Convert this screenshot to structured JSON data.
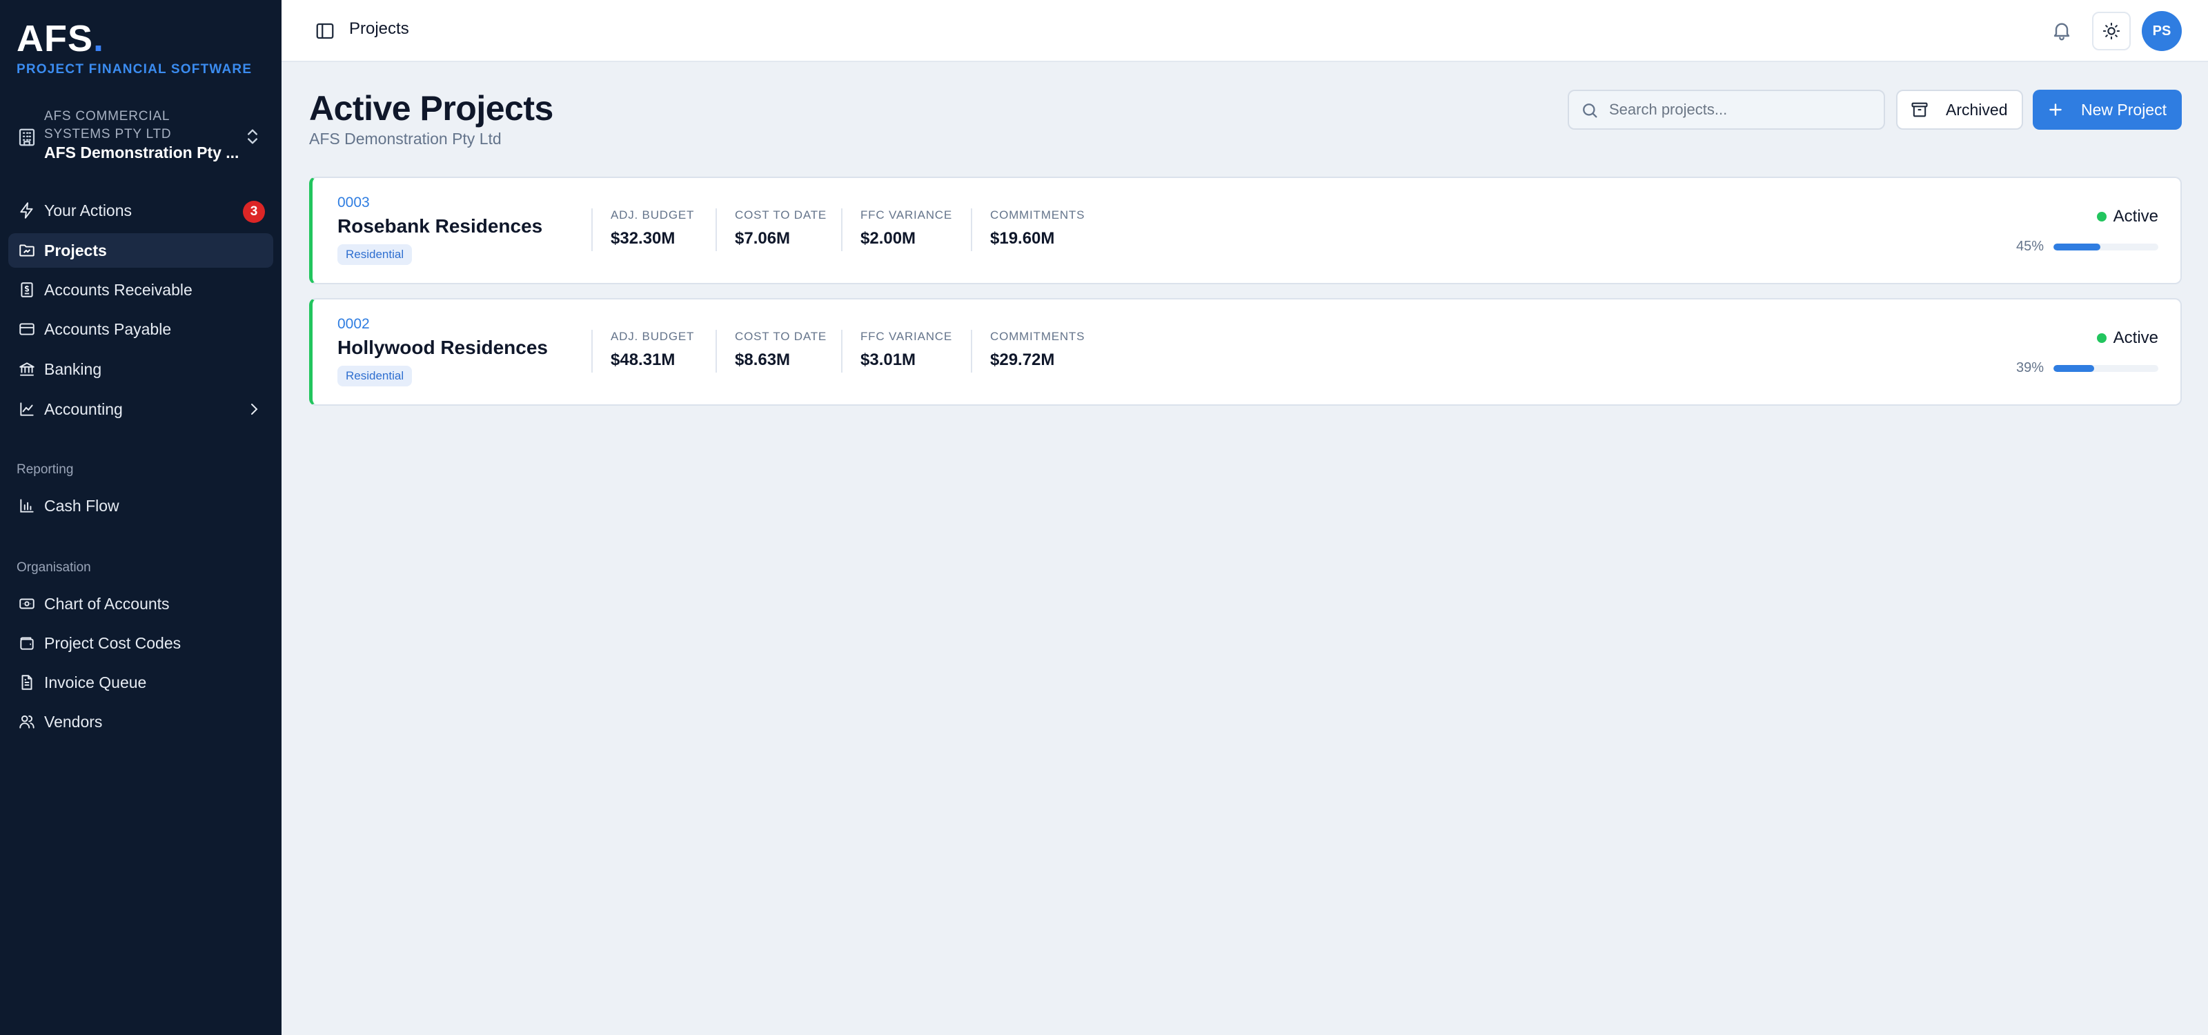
{
  "brand": {
    "logo_text": "AFS",
    "logo_dot": ".",
    "tagline": "PROJECT FINANCIAL SOFTWARE"
  },
  "org": {
    "parent": "AFS COMMERCIAL SYSTEMS PTY LTD",
    "name": "AFS Demonstration Pty ..."
  },
  "nav": {
    "items": [
      {
        "label": "Your Actions",
        "icon": "lightning-icon",
        "badge": "3"
      },
      {
        "label": "Projects",
        "icon": "folder-icon",
        "active": true
      },
      {
        "label": "Accounts Receivable",
        "icon": "receipt-dollar-icon"
      },
      {
        "label": "Accounts Payable",
        "icon": "credit-card-icon"
      },
      {
        "label": "Banking",
        "icon": "bank-icon"
      },
      {
        "label": "Accounting",
        "icon": "line-chart-icon"
      }
    ],
    "reporting_label": "Reporting",
    "reporting": [
      {
        "label": "Cash Flow",
        "icon": "bar-chart-icon"
      }
    ],
    "organisation_label": "Organisation",
    "organisation": [
      {
        "label": "Chart of Accounts",
        "icon": "banknote-icon"
      },
      {
        "label": "Project Cost Codes",
        "icon": "wallet-icon"
      },
      {
        "label": "Invoice Queue",
        "icon": "document-icon"
      },
      {
        "label": "Vendors",
        "icon": "users-icon"
      }
    ]
  },
  "topbar": {
    "title": "Projects",
    "avatar_initials": "PS"
  },
  "header": {
    "title": "Active Projects",
    "subtitle": "AFS Demonstration Pty Ltd",
    "search_placeholder": "Search projects...",
    "archived_label": "Archived",
    "new_project_label": "New Project"
  },
  "projects": [
    {
      "code": "0003",
      "name": "Rosebank Residences",
      "tag": "Residential",
      "metrics": [
        {
          "label": "ADJ. BUDGET",
          "value": "$32.30M"
        },
        {
          "label": "COST TO DATE",
          "value": "$7.06M"
        },
        {
          "label": "FFC VARIANCE",
          "value": "$2.00M"
        },
        {
          "label": "COMMITMENTS",
          "value": "$19.60M"
        }
      ],
      "status": "Active",
      "progress_label": "45%",
      "progress": 45
    },
    {
      "code": "0002",
      "name": "Hollywood Residences",
      "tag": "Residential",
      "metrics": [
        {
          "label": "ADJ. BUDGET",
          "value": "$48.31M"
        },
        {
          "label": "COST TO DATE",
          "value": "$8.63M"
        },
        {
          "label": "FFC VARIANCE",
          "value": "$3.01M"
        },
        {
          "label": "COMMITMENTS",
          "value": "$29.72M"
        }
      ],
      "status": "Active",
      "progress_label": "39%",
      "progress": 39
    }
  ],
  "colors": {
    "sidebar_bg": "#0d1a2e",
    "accent": "#2f7de1",
    "status_active": "#22c55e",
    "badge": "#dc2626"
  }
}
